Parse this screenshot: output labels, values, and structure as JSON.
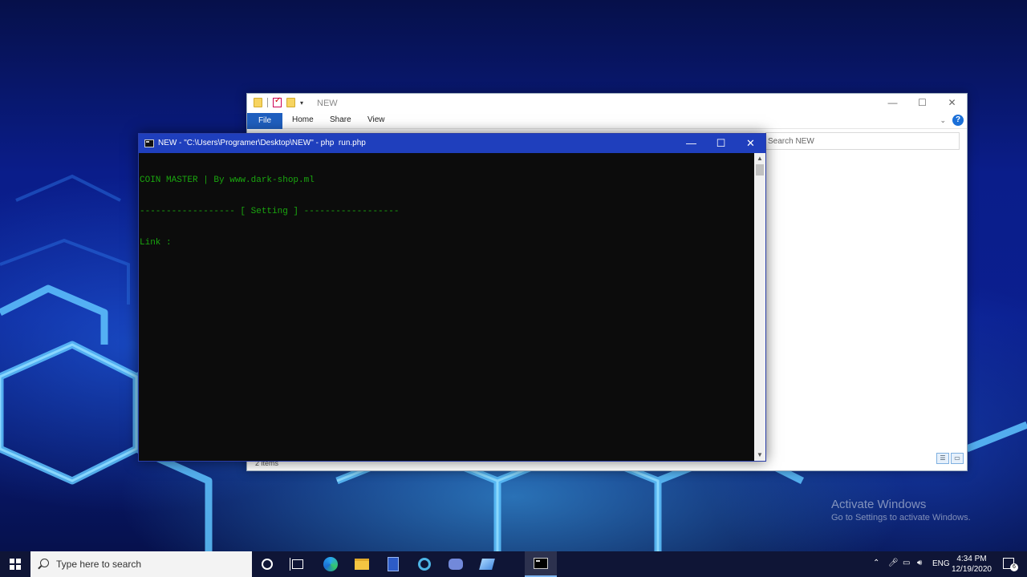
{
  "explorer": {
    "title": "NEW",
    "ribbon_tabs": {
      "file": "File",
      "home": "Home",
      "share": "Share",
      "view": "View"
    },
    "search_placeholder": "Search NEW",
    "status": "2 items",
    "help": "?"
  },
  "console": {
    "title": "NEW - \"C:\\Users\\Programer\\Desktop\\NEW\" - php  run.php",
    "lines": [
      "COIN MASTER | By www.dark-shop.ml",
      "------------------ [ Setting ] ------------------",
      "Link :"
    ],
    "text_color": "#1aa60f",
    "background": "#0c0c0c"
  },
  "watermark": {
    "title": "Activate Windows",
    "subtitle": "Go to Settings to activate Windows."
  },
  "taskbar": {
    "search_placeholder": "Type here to search",
    "language": "ENG",
    "time": "4:34 PM",
    "date": "12/19/2020",
    "notification_count": "6",
    "pinned_icons": [
      "cortana-icon",
      "task-view-icon",
      "edge-icon",
      "file-explorer-icon",
      "document-app-icon",
      "settings-app-icon",
      "discord-icon",
      "feather-app-icon",
      "command-prompt-icon"
    ]
  },
  "colors": {
    "console_titlebar": "#1f3fbd",
    "explorer_file_tab": "#1f5fbf",
    "taskbar": "#0f1536"
  }
}
